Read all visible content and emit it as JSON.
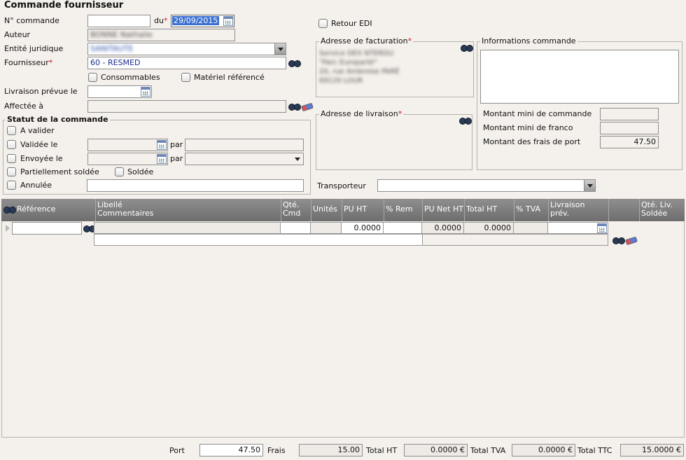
{
  "page_title": "Commande fournisseur",
  "header": {
    "numero_label": "N° commande",
    "numero_value": "",
    "du_label": "du",
    "required_mark": "*",
    "date_value": "29/09/2015",
    "auteur_label": "Auteur",
    "auteur_value": "BONNE Nathalie",
    "entite_label": "Entité juridique",
    "entite_value": "SANITAUTE",
    "fournisseur_label": "Fournisseur",
    "fournisseur_value": "60 - RESMED",
    "consommables_label": "Consommables",
    "materiel_label": "Matériel référencé",
    "livraison_label": "Livraison prévue le",
    "livraison_value": "",
    "affectee_label": "Affectée à",
    "affectee_value": "",
    "retour_edi_label": "Retour EDI"
  },
  "statut": {
    "legend": "Statut de la commande",
    "a_valider": "A valider",
    "validee": "Validée le",
    "envoyee": "Envoyée le",
    "par": "par",
    "partiellement": "Partiellement soldée",
    "soldee": "Soldée",
    "annulee": "Annulée"
  },
  "facturation": {
    "legend": "Adresse de facturation",
    "lines": [
      "Service DEX NTERDU",
      "\"Parc Europarté\"",
      "20, rue Ambroise PARÉ",
      "69120 LOUR"
    ]
  },
  "livraison": {
    "legend": "Adresse de livraison"
  },
  "infos": {
    "legend": "Informations commande",
    "mini_commande_label": "Montant mini de commande",
    "mini_commande_value": "",
    "mini_franco_label": "Montant mini de franco",
    "mini_franco_value": "",
    "frais_port_label": "Montant des frais de port",
    "frais_port_value": "47.50"
  },
  "transporteur": {
    "label": "Transporteur",
    "value": ""
  },
  "grid": {
    "columns": [
      "Référence",
      "Libellé\nCommentaires",
      "Qté.\nCmd",
      "Unités",
      "PU HT",
      "% Rem",
      "PU Net HT",
      "Total HT",
      "% TVA",
      "Livraison\nprév.",
      "",
      "Qté. Liv.\nSoldée"
    ],
    "row": {
      "reference": "",
      "pu_ht": "0.0000",
      "pu_net_ht": "0.0000",
      "total_ht": "0.0000"
    }
  },
  "footer": {
    "port_label": "Port",
    "port_value": "47.50",
    "frais_label": "Frais",
    "frais_value": "15.00",
    "total_ht_label": "Total HT",
    "total_ht_value": "0.0000 €",
    "total_tva_label": "Total TVA",
    "total_tva_value": "0.0000 €",
    "total_ttc_label": "Total TTC",
    "total_ttc_value": "15.0000 €"
  }
}
